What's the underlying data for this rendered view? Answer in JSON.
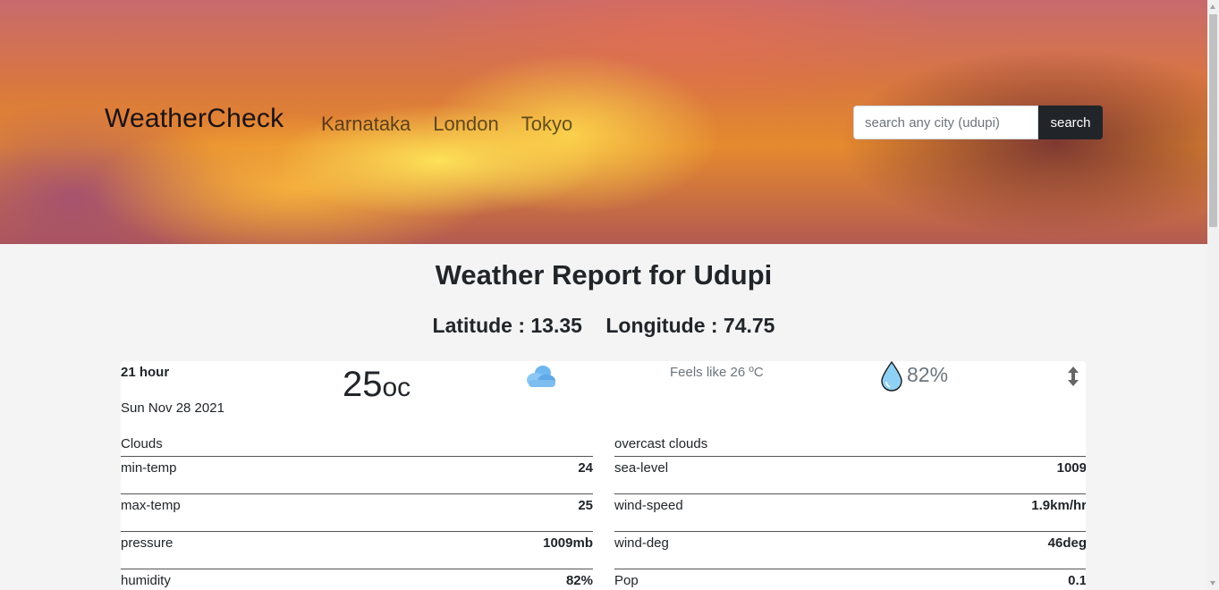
{
  "header": {
    "brand": "WeatherCheck",
    "nav": [
      "Karnataka",
      "London",
      "Tokyo"
    ],
    "search": {
      "placeholder": "search any city (udupi)",
      "button_label": "search"
    }
  },
  "report": {
    "title": "Weather Report for Udupi",
    "latitude": "Latitude : 13.35",
    "longitude": "Longitude : 74.75"
  },
  "card": {
    "hour": "21 hour",
    "date": "Sun Nov 28 2021",
    "temp_value": "25",
    "temp_unit": "oc",
    "feels_like": "Feels like 26 ºC",
    "humidity_pct": "82%",
    "weather_icon": "cloud-icon",
    "left_table": {
      "header": "Clouds",
      "rows": [
        {
          "label": "min-temp",
          "value": "24"
        },
        {
          "label": "max-temp",
          "value": "25"
        },
        {
          "label": "pressure",
          "value": "1009mb"
        },
        {
          "label": "humidity",
          "value": "82%"
        }
      ]
    },
    "right_table": {
      "header": "overcast clouds",
      "rows": [
        {
          "label": "sea-level",
          "value": "1009"
        },
        {
          "label": "wind-speed",
          "value": "1.9km/hr"
        },
        {
          "label": "wind-deg",
          "value": "46deg"
        },
        {
          "label": "Pop",
          "value": "0.1"
        }
      ]
    }
  }
}
